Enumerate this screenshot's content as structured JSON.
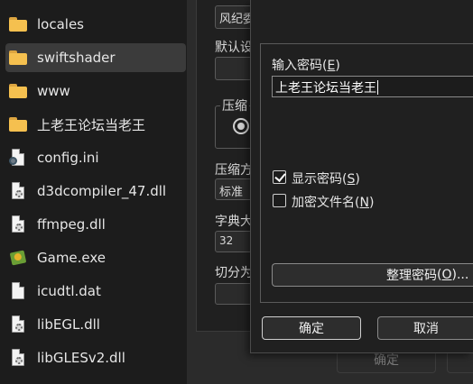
{
  "files": [
    {
      "name": "locales",
      "icon": "folder-icon",
      "selected": false
    },
    {
      "name": "swiftshader",
      "icon": "folder-icon",
      "selected": true
    },
    {
      "name": "www",
      "icon": "folder-icon",
      "selected": false
    },
    {
      "name": "上老王论坛当老王",
      "icon": "folder-icon",
      "selected": false
    },
    {
      "name": "config.ini",
      "icon": "settings-file-icon",
      "selected": false
    },
    {
      "name": "d3dcompiler_47.dll",
      "icon": "dll-file-icon",
      "selected": false
    },
    {
      "name": "ffmpeg.dll",
      "icon": "dll-file-icon",
      "selected": false
    },
    {
      "name": "Game.exe",
      "icon": "exe-file-icon",
      "selected": false
    },
    {
      "name": "icudtl.dat",
      "icon": "file-icon",
      "selected": false
    },
    {
      "name": "libEGL.dll",
      "icon": "dll-file-icon",
      "selected": false
    },
    {
      "name": "libGLESv2.dll",
      "icon": "dll-file-icon",
      "selected": false
    }
  ],
  "background_window": {
    "archive_name_value": "风纪委",
    "default_label": "默认设",
    "compression_label": "压缩",
    "compression_method_label": "压缩方",
    "compression_method_value": "标准",
    "dictionary_label": "字典大",
    "dictionary_value": "32",
    "split_label": "切分为",
    "ok_button": "确定"
  },
  "password_dialog": {
    "input_label": "输入密码",
    "input_label_shortcut": "E",
    "password_value": "上老王论坛当老王",
    "show_password_label": "显示密码",
    "show_password_shortcut": "S",
    "show_password_checked": true,
    "encrypt_names_label": "加密文件名",
    "encrypt_names_shortcut": "N",
    "encrypt_names_checked": false,
    "organize_button_label": "整理密码",
    "organize_button_shortcut": "O",
    "ok_button": "确定",
    "cancel_button": "取消"
  },
  "colors": {
    "folder": "#f5c04f",
    "selection": "#3b3b3b",
    "dialog_bg": "#202020"
  }
}
